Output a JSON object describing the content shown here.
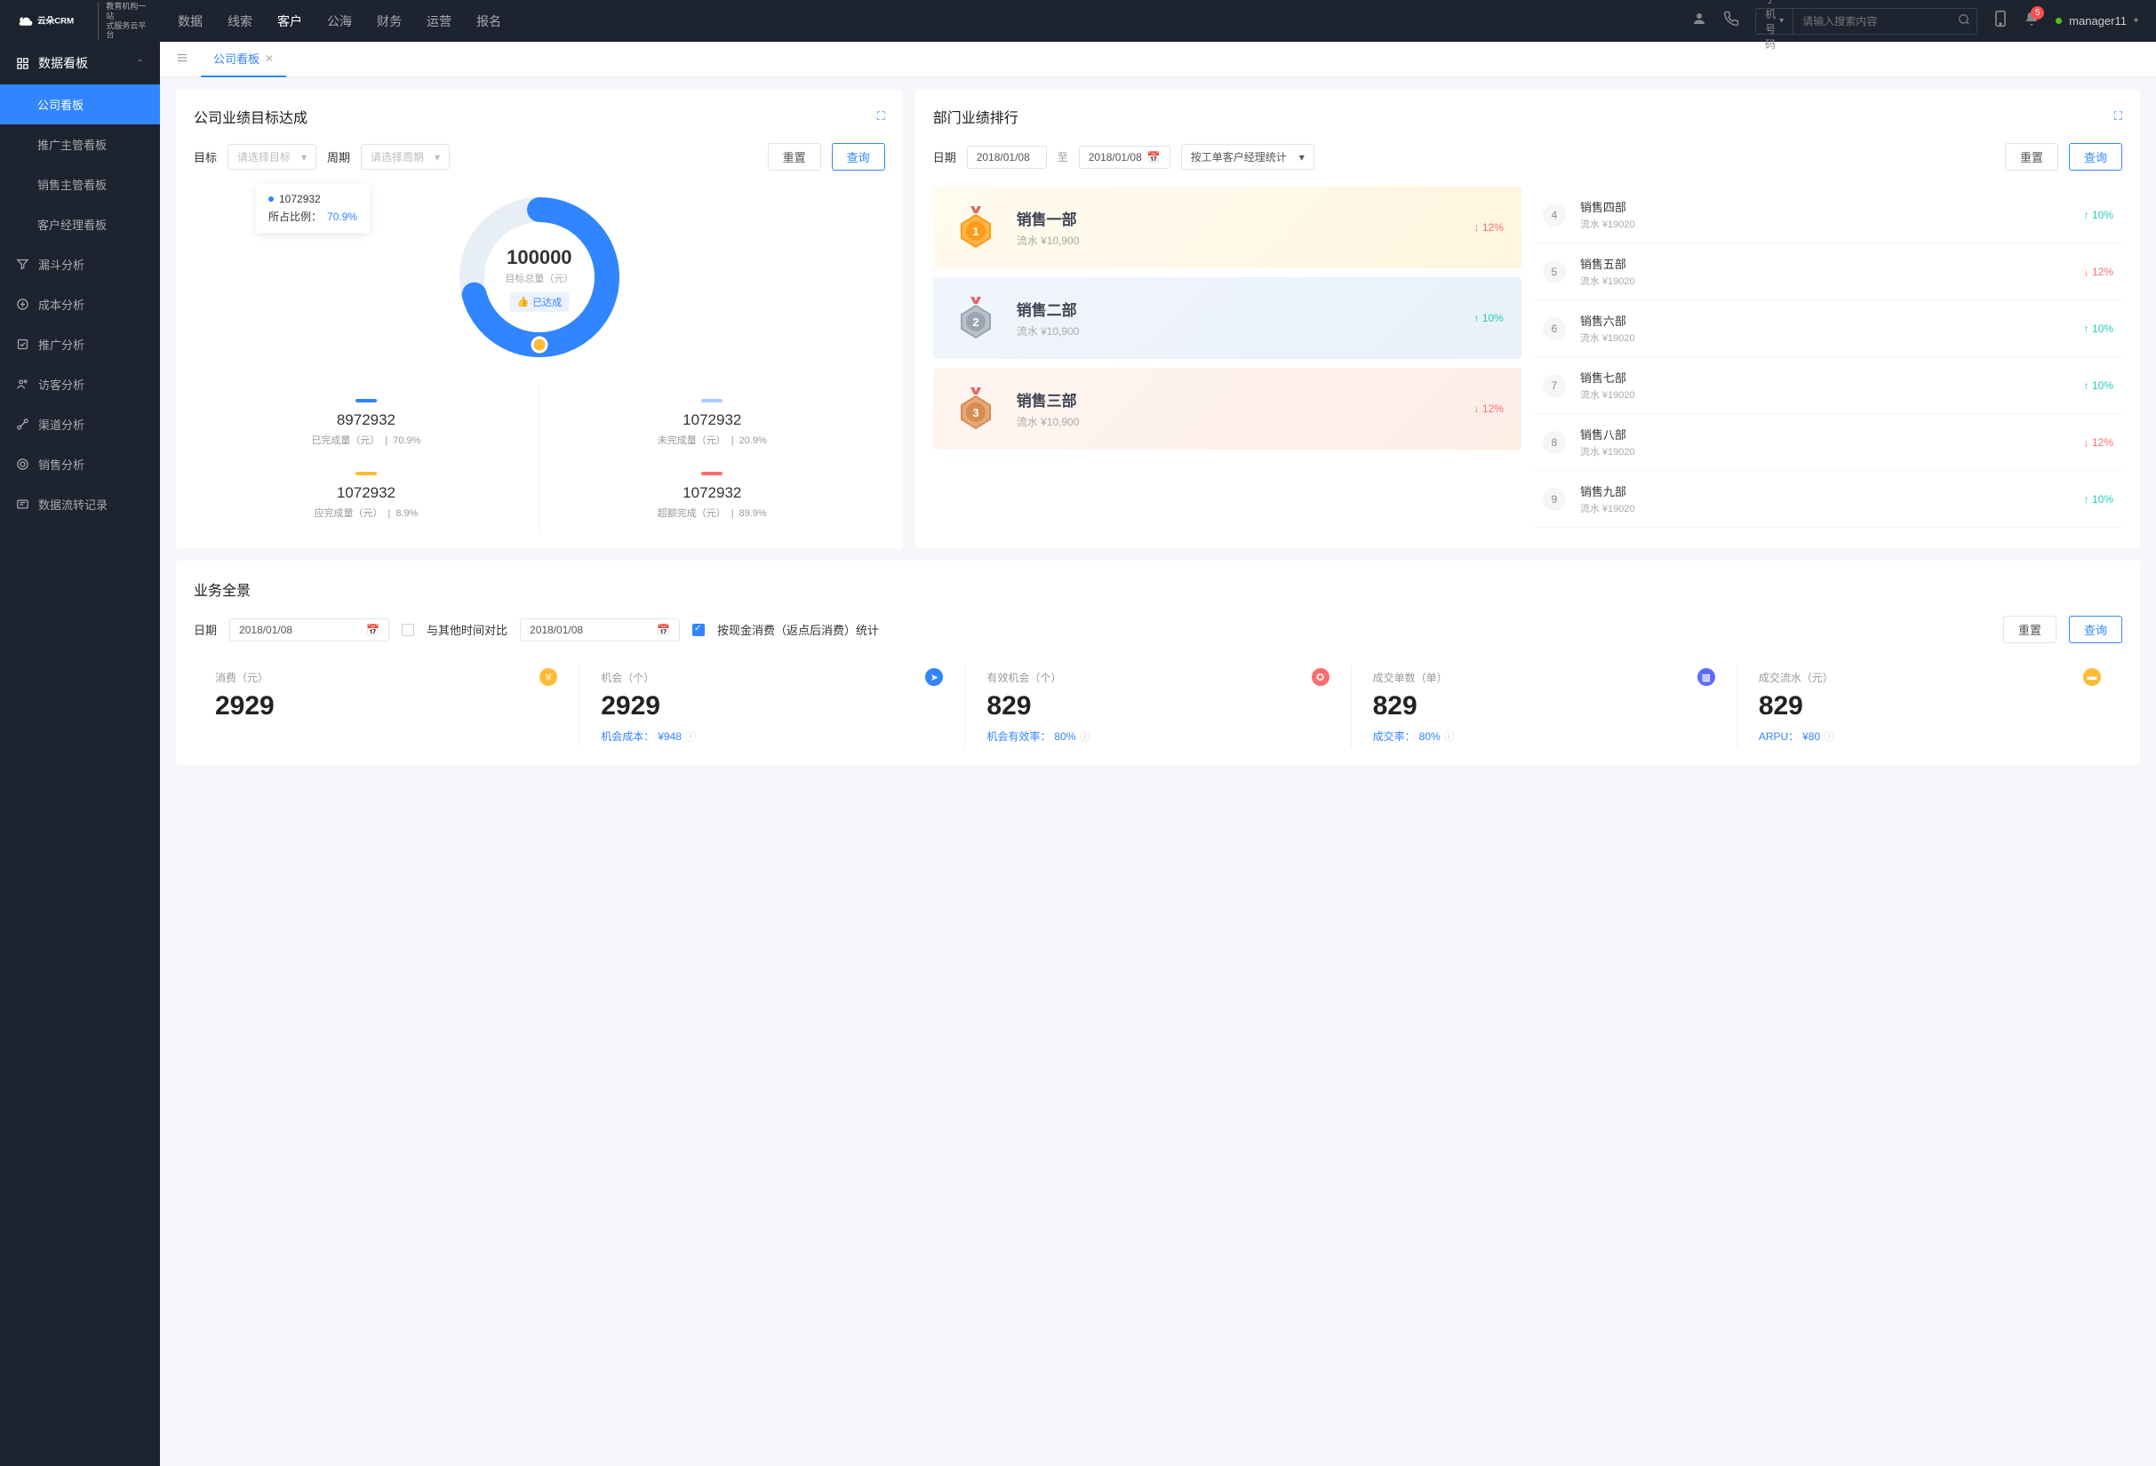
{
  "header": {
    "logo_main": "云朵CRM",
    "logo_sub1": "教育机构一站",
    "logo_sub2": "式服务云平台",
    "nav": [
      "数据",
      "线索",
      "客户",
      "公海",
      "财务",
      "运营",
      "报名"
    ],
    "active_nav_index": 2,
    "search_type": "手机号码",
    "search_placeholder": "请输入搜索内容",
    "notif_count": "5",
    "user_name": "manager11"
  },
  "sidebar": {
    "group_header": "数据看板",
    "sub_items": [
      "公司看板",
      "推广主管看板",
      "销售主管看板",
      "客户经理看板"
    ],
    "active_sub_index": 0,
    "items": [
      {
        "icon": "funnel",
        "label": "漏斗分析"
      },
      {
        "icon": "cost",
        "label": "成本分析"
      },
      {
        "icon": "promo",
        "label": "推广分析"
      },
      {
        "icon": "visitor",
        "label": "访客分析"
      },
      {
        "icon": "channel",
        "label": "渠道分析"
      },
      {
        "icon": "sales",
        "label": "销售分析"
      },
      {
        "icon": "flow",
        "label": "数据流转记录"
      }
    ]
  },
  "tabs": {
    "current": "公司看板"
  },
  "goal_panel": {
    "title": "公司业绩目标达成",
    "target_label": "目标",
    "target_placeholder": "请选择目标",
    "period_label": "周期",
    "period_placeholder": "请选择周期",
    "reset_btn": "重置",
    "query_btn": "查询",
    "tooltip_value": "1072932",
    "tooltip_ratio_label": "所占比例：",
    "tooltip_ratio": "70.9%",
    "center_value": "100000",
    "center_label": "目标总量（元）",
    "center_badge": "已达成",
    "metrics": [
      {
        "dash": "#3185ff",
        "value": "8972932",
        "label": "已完成量（元）",
        "pct": "70.9%"
      },
      {
        "dash": "#a9cbff",
        "value": "1072932",
        "label": "未完成量（元）",
        "pct": "20.9%"
      },
      {
        "dash": "#ffbb33",
        "value": "1072932",
        "label": "应完成量（元）",
        "pct": "8.9%"
      },
      {
        "dash": "#ff6b6b",
        "value": "1072932",
        "label": "超额完成（元）",
        "pct": "89.9%"
      }
    ]
  },
  "rank_panel": {
    "title": "部门业绩排行",
    "date_label": "日期",
    "date_from": "2018/01/08",
    "date_sep": "至",
    "date_to": "2018/01/08",
    "stat_select": "按工单客户经理统计",
    "reset_btn": "重置",
    "query_btn": "查询",
    "top3": [
      {
        "class": "rank-gold",
        "rank": "1",
        "name": "销售一部",
        "sub_label": "流水",
        "amount": "¥10,900",
        "trend_dir": "down",
        "trend_pct": "12%",
        "medal_fill": "#ffb648",
        "medal_stroke": "#ff9a1a"
      },
      {
        "class": "rank-silver",
        "rank": "2",
        "name": "销售二部",
        "sub_label": "流水",
        "amount": "¥10,900",
        "trend_dir": "up",
        "trend_pct": "10%",
        "medal_fill": "#b8c2cc",
        "medal_stroke": "#9aa5b0"
      },
      {
        "class": "rank-bronze",
        "rank": "3",
        "name": "销售三部",
        "sub_label": "流水",
        "amount": "¥10,900",
        "trend_dir": "down",
        "trend_pct": "12%",
        "medal_fill": "#e8a876",
        "medal_stroke": "#d68d54"
      }
    ],
    "rest": [
      {
        "num": "4",
        "name": "销售四部",
        "sub_label": "流水",
        "amount": "¥19020",
        "trend_dir": "up",
        "trend_pct": "10%"
      },
      {
        "num": "5",
        "name": "销售五部",
        "sub_label": "流水",
        "amount": "¥19020",
        "trend_dir": "down",
        "trend_pct": "12%"
      },
      {
        "num": "6",
        "name": "销售六部",
        "sub_label": "流水",
        "amount": "¥19020",
        "trend_dir": "up",
        "trend_pct": "10%"
      },
      {
        "num": "7",
        "name": "销售七部",
        "sub_label": "流水",
        "amount": "¥19020",
        "trend_dir": "up",
        "trend_pct": "10%"
      },
      {
        "num": "8",
        "name": "销售八部",
        "sub_label": "流水",
        "amount": "¥19020",
        "trend_dir": "down",
        "trend_pct": "12%"
      },
      {
        "num": "9",
        "name": "销售九部",
        "sub_label": "流水",
        "amount": "¥19020",
        "trend_dir": "up",
        "trend_pct": "10%"
      }
    ]
  },
  "biz_panel": {
    "title": "业务全景",
    "date_label": "日期",
    "date_value": "2018/01/08",
    "compare_label": "与其他时间对比",
    "date_value2": "2018/01/08",
    "cash_label": "按现金消费（返点后消费）统计",
    "reset_btn": "重置",
    "query_btn": "查询",
    "kpis": [
      {
        "label": "消费（元）",
        "icon_bg": "#ffbb33",
        "icon_glyph": "￥",
        "value": "2929",
        "sub_label": "",
        "sub_val": ""
      },
      {
        "label": "机会（个）",
        "icon_bg": "#3185ff",
        "icon_glyph": "➤",
        "value": "2929",
        "sub_label": "机会成本：",
        "sub_val": "¥948"
      },
      {
        "label": "有效机会（个）",
        "icon_bg": "#ff6b6b",
        "icon_glyph": "✪",
        "value": "829",
        "sub_label": "机会有效率：",
        "sub_val": "80%"
      },
      {
        "label": "成交单数（单）",
        "icon_bg": "#5a6cff",
        "icon_glyph": "▦",
        "value": "829",
        "sub_label": "成交率：",
        "sub_val": "80%"
      },
      {
        "label": "成交流水（元）",
        "icon_bg": "#ffbb33",
        "icon_glyph": "▬",
        "value": "829",
        "sub_label": "ARPU：",
        "sub_val": "¥80"
      }
    ]
  },
  "chart_data": {
    "type": "pie",
    "title": "目标总量（元）",
    "total": 100000,
    "series": [
      {
        "name": "已完成量（元）",
        "value": 8972932,
        "pct": 70.9,
        "color": "#3185ff"
      },
      {
        "name": "未完成量（元）",
        "value": 1072932,
        "pct": 20.9,
        "color": "#a9cbff"
      },
      {
        "name": "应完成量（元）",
        "value": 1072932,
        "pct": 8.9,
        "color": "#ffbb33"
      },
      {
        "name": "超额完成（元）",
        "value": 1072932,
        "pct": 89.9,
        "color": "#ff6b6b"
      }
    ]
  }
}
